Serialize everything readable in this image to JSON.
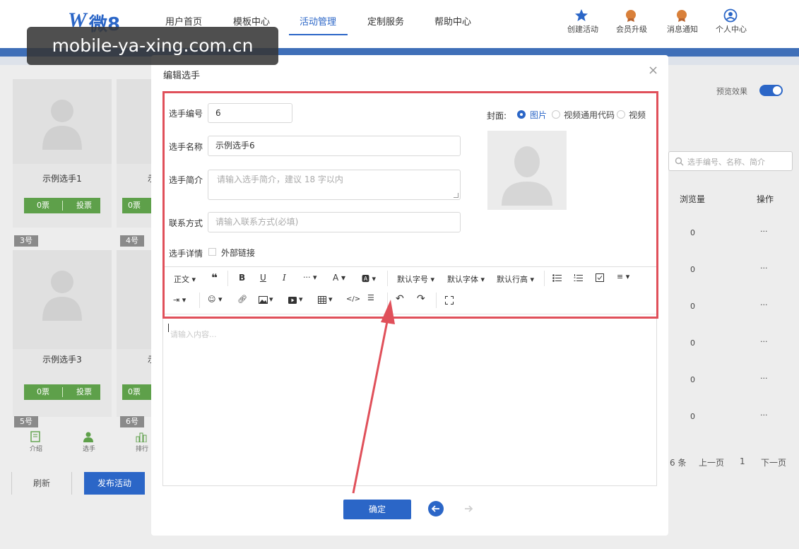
{
  "header": {
    "logo_w": "W",
    "logo_text": "微8",
    "nav": [
      "用户首页",
      "模板中心",
      "活动管理",
      "定制服务",
      "帮助中心"
    ],
    "nav_active_index": 2,
    "actions": [
      {
        "label": "创建活动",
        "icon": "star-icon"
      },
      {
        "label": "会员升级",
        "icon": "medal-icon"
      },
      {
        "label": "消息通知",
        "icon": "bell-medal-icon"
      },
      {
        "label": "个人中心",
        "icon": "user-circle-icon"
      }
    ]
  },
  "watermark": "mobile-ya-xing.com.cn",
  "background": {
    "cards": [
      {
        "name": "示例选手1",
        "votes": "0票",
        "vote_btn": "投票",
        "tag": "3号"
      },
      {
        "name": "示例选手3",
        "votes": "0票",
        "vote_btn": "投票",
        "tag": "5号"
      }
    ],
    "partial_cards": [
      {
        "name": "示",
        "votes": "0票",
        "tag": "4号"
      },
      {
        "name": "示",
        "votes": "0票",
        "tag": "6号"
      }
    ],
    "bottom_nav": [
      "介绍",
      "选手",
      "排行"
    ],
    "refresh": "刷新",
    "publish": "发布活动",
    "preview_label": "预览效果",
    "search_placeholder": "选手编号、名称、简介",
    "table_headers": [
      "浏览量",
      "操作"
    ],
    "rows": [
      {
        "views": "0",
        "op": "···"
      },
      {
        "views": "0",
        "op": "···"
      },
      {
        "views": "0",
        "op": "···"
      },
      {
        "views": "0",
        "op": "···"
      },
      {
        "views": "0",
        "op": "···"
      },
      {
        "views": "0",
        "op": "···"
      }
    ],
    "pagination": {
      "total": "6 条",
      "prev": "上一页",
      "page": "1",
      "next": "下一页"
    }
  },
  "modal": {
    "title": "编辑选手",
    "close": "×",
    "fields": {
      "number_label": "选手编号",
      "number_value": "6",
      "name_label": "选手名称",
      "name_value": "示例选手6",
      "intro_label": "选手简介",
      "intro_placeholder": "请输入选手简介，建议 18 字以内",
      "contact_label": "联系方式",
      "contact_placeholder": "请输入联系方式(必填)",
      "detail_label": "选手详情",
      "external_link": "外部链接"
    },
    "cover": {
      "label": "封面:",
      "options": [
        "图片",
        "视频通用代码",
        "视频"
      ],
      "selected_index": 0
    },
    "toolbar": {
      "heading": "正文",
      "font_size": "默认字号",
      "font_family": "默认字体",
      "line_height": "默认行高"
    },
    "editor_placeholder": "请输入内容...",
    "confirm": "确定"
  },
  "colors": {
    "brand": "#2b66c7",
    "highlight_red": "#e0505a",
    "vote_green": "#5ea04a"
  }
}
